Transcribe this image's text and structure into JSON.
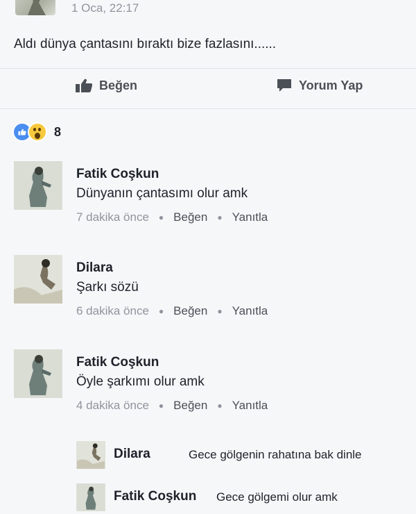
{
  "post": {
    "time": "1 Oca, 22:17",
    "text": "Aldı dünya çantasını bıraktı bize fazlasını......",
    "actions": {
      "like": "Beğen",
      "comment": "Yorum Yap"
    },
    "reaction_count": "8"
  },
  "comments": [
    {
      "name": "Fatik Coşkun",
      "text": "Dünyanın çantasımı olur amk",
      "time": "7 dakika önce",
      "like": "Beğen",
      "reply": "Yanıtla"
    },
    {
      "name": "Dilara",
      "text": "Şarkı sözü",
      "time": "6 dakika önce",
      "like": "Beğen",
      "reply": "Yanıtla"
    },
    {
      "name": "Fatik Coşkun",
      "text": "Öyle şarkımı olur amk",
      "time": "4 dakika önce",
      "like": "Beğen",
      "reply": "Yanıtla"
    }
  ],
  "replies": [
    {
      "name": "Dilara",
      "text": "Gece gölgenin rahatına bak  dinle"
    },
    {
      "name": "Fatik Coşkun",
      "text": "Gece gölgemi olur amk"
    }
  ],
  "icons": {
    "like": "thumbs-up-icon",
    "comment": "speech-bubble-icon",
    "reaction_like": "like-reaction-icon",
    "reaction_wow": "wow-reaction-icon"
  },
  "colors": {
    "accent": "#4a8ef0",
    "text": "#1d2129",
    "muted": "#90949c",
    "background": "#f6f7f9"
  }
}
